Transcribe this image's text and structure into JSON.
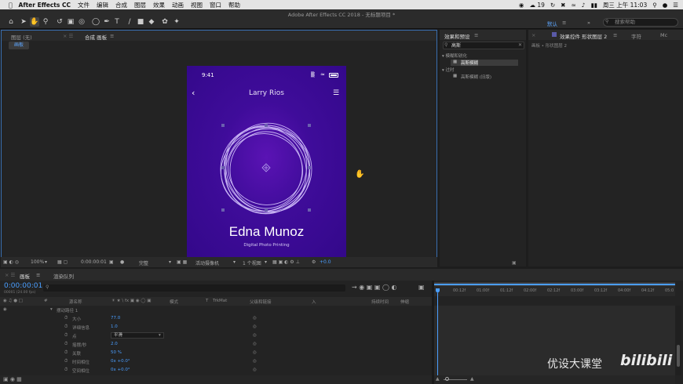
{
  "menubar": {
    "app": "After Effects CC",
    "items": [
      "文件",
      "编辑",
      "合成",
      "图层",
      "效果",
      "动画",
      "视图",
      "窗口",
      "帮助"
    ],
    "notif": "19",
    "clock": "周三 上午 11:03"
  },
  "toolbar": {
    "window_title": "Adobe After Effects CC 2018 - 无标题项目 *",
    "workspace_default": "默认",
    "workspace_more": "»",
    "search_placeholder": "搜索帮助"
  },
  "panels": {
    "layer_tab": "图层 (无)",
    "comp_tab": "合成 画板",
    "comp_sub": "画板",
    "effects_tab": "效果和预设",
    "effects_search": "高斯",
    "effects_tree": [
      {
        "label": "模糊和锐化",
        "child": "高斯模糊"
      },
      {
        "label": "过时",
        "child": "高斯模糊 (旧版)"
      }
    ],
    "effctl_tab": "效果控件 形状图层 2",
    "char_tab": "字符",
    "effctl_sub": "画板 • 形状图层 2",
    "mc_tab": "Mc"
  },
  "phone": {
    "time": "9:41",
    "header": "Larry Rios",
    "name": "Edna Munoz",
    "subtitle": "Digital Photo Printing"
  },
  "viewerbar": {
    "zoom": "100%",
    "timecode": "0:00:00:01",
    "quality": "完整",
    "camera": "活动摄像机",
    "views": "1 个视图",
    "exposure": "+0.0"
  },
  "timeline": {
    "tab": "画板",
    "render_tab": "渲染队列",
    "timecode": "0:00:00:01",
    "fps": "00001 (24.00 fps)",
    "col_headers": {
      "num": "#",
      "source": "源名称",
      "mode": "模式",
      "t": "T",
      "trkmat": "TrkMat",
      "parent": "父级和链接",
      "in": "入",
      "duration": "持续时间",
      "stretch": "伸缩"
    },
    "group": "摆动路径 1",
    "props": [
      {
        "label": "大小",
        "value": "77.0"
      },
      {
        "label": "详细信息",
        "value": "1.0"
      },
      {
        "label": "点",
        "value": "平滑"
      },
      {
        "label": "摇摆/秒",
        "value": "2.0"
      },
      {
        "label": "关联",
        "value": "50 %"
      },
      {
        "label": "时间相位",
        "value": "0x +0.0°"
      },
      {
        "label": "空间相位",
        "value": "0x +0.0°"
      }
    ],
    "ruler": [
      "00:12f",
      "01:00f",
      "01:12f",
      "02:00f",
      "02:12f",
      "03:00f",
      "03:12f",
      "04:00f",
      "04:12f",
      "05:0"
    ]
  },
  "watermark": {
    "text": "优设大课堂",
    "logo": "bilibili"
  }
}
